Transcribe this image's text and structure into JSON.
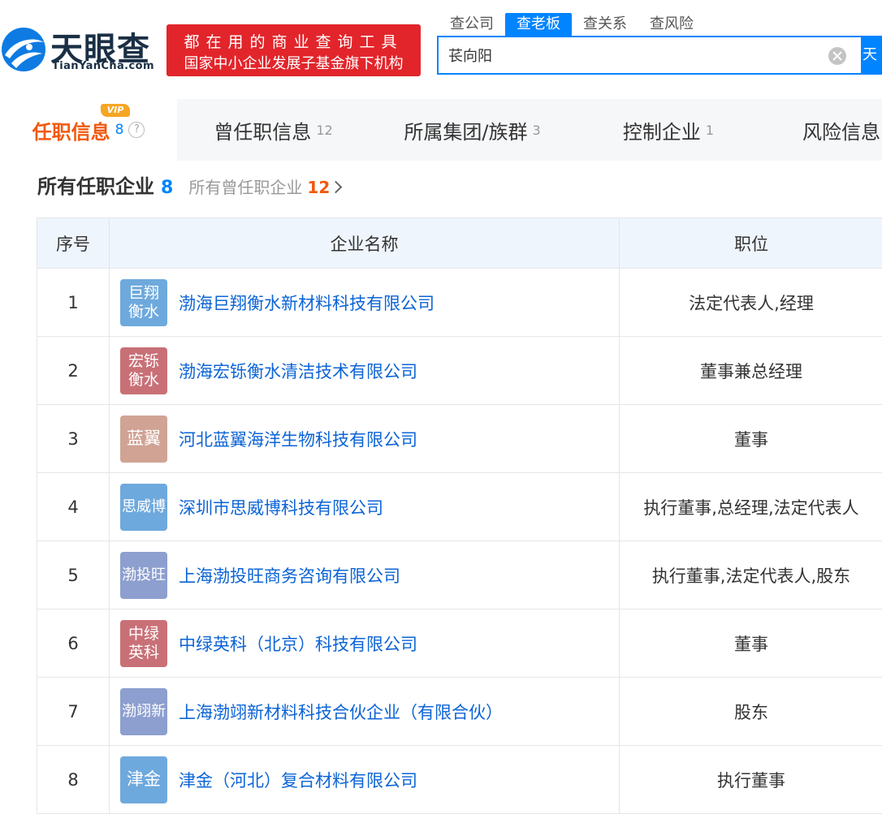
{
  "header": {
    "logo_cn": "天眼查",
    "logo_en": "TianYanCha.com",
    "slogan_line1": "都在用的商业查询工具",
    "slogan_line2": "国家中小企业发展子基金旗下机构",
    "search_tabs": [
      {
        "label": "查公司",
        "active": false
      },
      {
        "label": "查老板",
        "active": true
      },
      {
        "label": "查关系",
        "active": false
      },
      {
        "label": "查风险",
        "active": false
      }
    ],
    "search_value": "苌向阳",
    "search_button_label": "天"
  },
  "category_tabs": {
    "vip_badge": "VIP",
    "help_glyph": "?",
    "items": [
      {
        "label": "任职信息",
        "count": "8",
        "active": true
      },
      {
        "label": "曾任职信息",
        "count": "12",
        "active": false
      },
      {
        "label": "所属集团/族群",
        "count": "3",
        "active": false
      },
      {
        "label": "控制企业",
        "count": "1",
        "active": false
      },
      {
        "label": "风险信息",
        "count": "",
        "active": false
      }
    ]
  },
  "section": {
    "title": "所有任职企业",
    "count": "8",
    "link_label": "所有曾任职企业",
    "link_count": "12"
  },
  "table": {
    "headers": [
      "序号",
      "企业名称",
      "职位"
    ],
    "rows": [
      {
        "seq": "1",
        "avatar": "巨翔衡水",
        "avatar_color": "#6ea9dd",
        "company": "渤海巨翔衡水新材料科技有限公司",
        "position": "法定代表人,经理"
      },
      {
        "seq": "2",
        "avatar": "宏铄衡水",
        "avatar_color": "#c97077",
        "company": "渤海宏铄衡水清洁技术有限公司",
        "position": "董事兼总经理"
      },
      {
        "seq": "3",
        "avatar": "蓝翼",
        "avatar_color": "#d0a394",
        "company": "河北蓝翼海洋生物科技有限公司",
        "position": "董事"
      },
      {
        "seq": "4",
        "avatar": "思威博",
        "avatar_color": "#6ea9dd",
        "company": "深圳市思威博科技有限公司",
        "position": "执行董事,总经理,法定代表人"
      },
      {
        "seq": "5",
        "avatar": "渤投旺",
        "avatar_color": "#8d9fcf",
        "company": "上海渤投旺商务咨询有限公司",
        "position": "执行董事,法定代表人,股东"
      },
      {
        "seq": "6",
        "avatar": "中绿英科",
        "avatar_color": "#c97077",
        "company": "中绿英科（北京）科技有限公司",
        "position": "董事"
      },
      {
        "seq": "7",
        "avatar": "渤翊新",
        "avatar_color": "#8d9fcf",
        "company": "上海渤翊新材料科技合伙企业（有限合伙）",
        "position": "股东"
      },
      {
        "seq": "8",
        "avatar": "津金",
        "avatar_color": "#6ea9dd",
        "company": "津金（河北）复合材料有限公司",
        "position": "执行董事"
      }
    ]
  }
}
